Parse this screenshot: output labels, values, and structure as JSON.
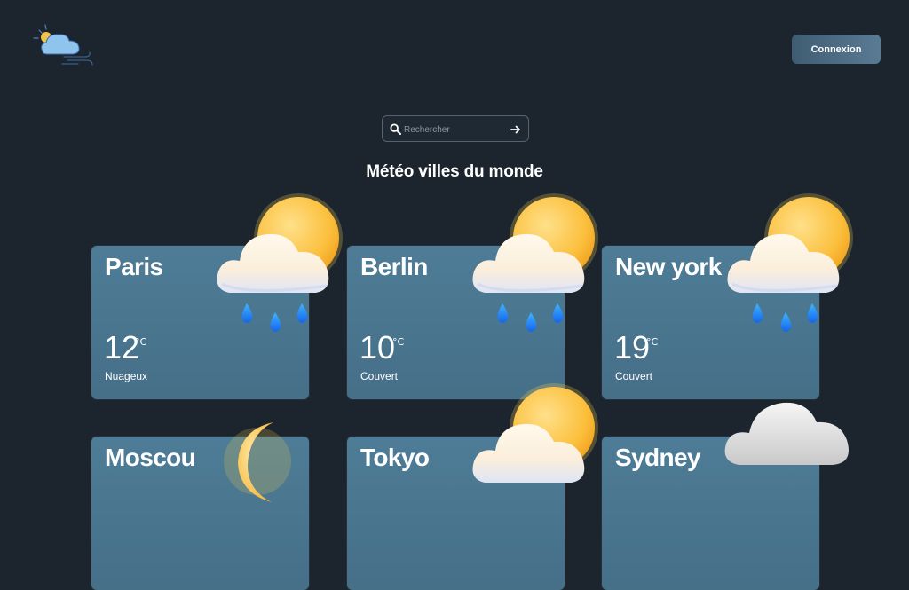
{
  "header": {
    "login_label": "Connexion"
  },
  "search": {
    "placeholder": "Rechercher"
  },
  "page": {
    "title": "Météo villes du monde"
  },
  "cities": [
    {
      "name": "Paris",
      "temp": "12",
      "unit": "°C",
      "condition": "Nuageux",
      "icon": "sun-cloud-rain-icon"
    },
    {
      "name": "Berlin",
      "temp": "10",
      "unit": "°C",
      "condition": "Couvert",
      "icon": "sun-cloud-rain-icon"
    },
    {
      "name": "New york",
      "temp": "19",
      "unit": "°C",
      "condition": "Couvert",
      "icon": "sun-cloud-rain-icon"
    },
    {
      "name": "Moscou",
      "icon": "moon-cloud-icon"
    },
    {
      "name": "Tokyo",
      "icon": "sun-cloud-icon"
    },
    {
      "name": "Sydney",
      "icon": "cloud-icon"
    }
  ],
  "colors": {
    "background": "#1c252e",
    "card": "#4e7c96",
    "button": "#4a6a82"
  }
}
